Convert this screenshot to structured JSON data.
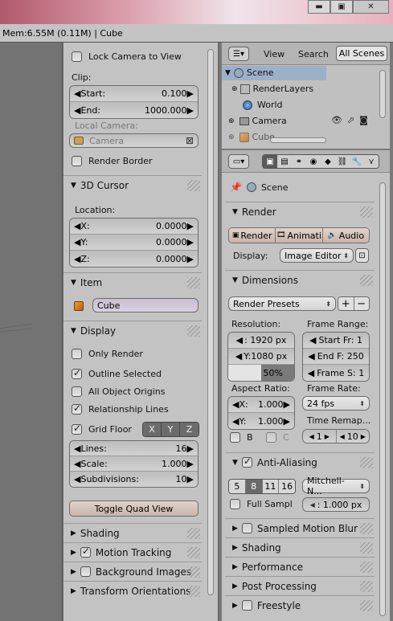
{
  "infobar": {
    "text": "Mem:6.55M (0.11M) | Cube"
  },
  "window": {
    "minimize": "▬",
    "maximize": "▣",
    "close": "✕"
  },
  "npanel": {
    "lock_camera": "Lock Camera to View",
    "clip_label": "Clip:",
    "clip_start_label": "Start:",
    "clip_start_value": "0.100",
    "clip_end_label": "End:",
    "clip_end_value": "1000.000",
    "local_camera_label": "Local Camera:",
    "camera_value": "Camera",
    "render_border": "Render Border",
    "cursor_header": "3D Cursor",
    "location_label": "Location:",
    "loc_x_label": "X:",
    "loc_x": "0.0000",
    "loc_y_label": "Y:",
    "loc_y": "0.0000",
    "loc_z_label": "Z:",
    "loc_z": "0.0000",
    "item_header": "Item",
    "item_name": "Cube",
    "display_header": "Display",
    "only_render": "Only Render",
    "outline_selected": "Outline Selected",
    "all_object_origins": "All Object Origins",
    "relationship_lines": "Relationship Lines",
    "grid_floor": "Grid Floor",
    "axis_x": "X",
    "axis_y": "Y",
    "axis_z": "Z",
    "lines_label": "Lines:",
    "lines_value": "16",
    "scale_label": "Scale:",
    "scale_value": "1.000",
    "subdiv_label": "Subdivisions:",
    "subdiv_value": "10",
    "toggle_quad": "Toggle Quad View",
    "shading_header": "Shading",
    "motion_tracking": "Motion Tracking",
    "background_images": "Background Images",
    "transform_orientations": "Transform Orientations"
  },
  "outliner": {
    "view": "View",
    "search": "Search",
    "all_scenes": "All Scenes",
    "items": [
      "Scene",
      "RenderLayers",
      "World",
      "Camera",
      "Cube"
    ]
  },
  "props": {
    "scene_label": "Scene",
    "render_header": "Render",
    "render_btn": "Render",
    "animation_btn": "Animati",
    "audio_btn": "Audio",
    "display_label": "Display:",
    "display_value": "Image Editor",
    "dimensions_header": "Dimensions",
    "render_presets": "Render Presets",
    "resolution_label": "Resolution:",
    "res_x": ": 1920 px",
    "res_y": "Y:1080 px",
    "res_pct": "50%",
    "frame_range_label": "Frame Range:",
    "start_fr": "Start Fr:  1",
    "end_f": "End F: 250",
    "frame_s": "Frame S: 1",
    "aspect_label": "Aspect Ratio:",
    "asp_x_label": "X:",
    "asp_x": "1.000",
    "asp_y_label": "Y:",
    "asp_y": "1.000",
    "frame_rate_label": "Frame Rate:",
    "fps": "24 fps",
    "b_label": "B",
    "c_label": "C",
    "time_remap": "Time Remap...",
    "remap_old": "1",
    "remap_new": "10",
    "aa_header": "Anti-Aliasing",
    "aa5": "5",
    "aa8": "8",
    "aa11": "11",
    "aa16": "16",
    "aa_filter": "Mitchell-N...",
    "full_sample": "Full Sampl",
    "filter_size": ": 1.000 px",
    "sampled_motion_blur": "Sampled Motion Blur",
    "shading": "Shading",
    "performance": "Performance",
    "post_processing": "Post Processing",
    "freestyle": "Freestyle"
  }
}
